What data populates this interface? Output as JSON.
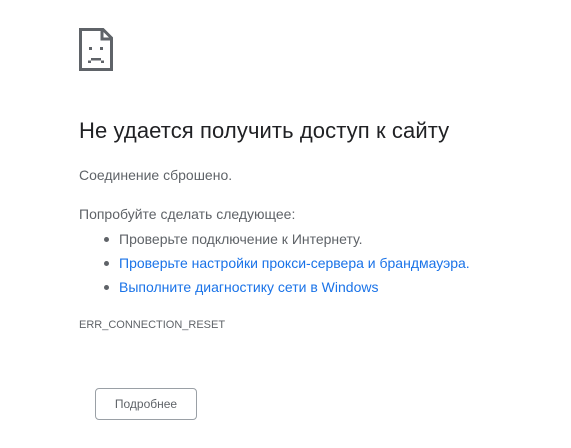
{
  "error": {
    "icon": "sad-page-icon",
    "title": "Не удается получить доступ к сайту",
    "reason": "Соединение сброшено.",
    "suggestions_heading": "Попробуйте сделать следующее:",
    "suggestions": [
      {
        "label": "Проверьте подключение к Интернету.",
        "link": false
      },
      {
        "label": "Проверьте настройки прокси-сервера и брандмауэра.",
        "link": true
      },
      {
        "label": "Выполните диагностику сети в Windows",
        "link": true
      }
    ],
    "code": "ERR_CONNECTION_RESET",
    "details_button_label": "Подробнее"
  },
  "colors": {
    "title": "#202124",
    "body_text": "#5f6368",
    "link": "#1a73e8",
    "button_border": "#9aa0a6"
  }
}
